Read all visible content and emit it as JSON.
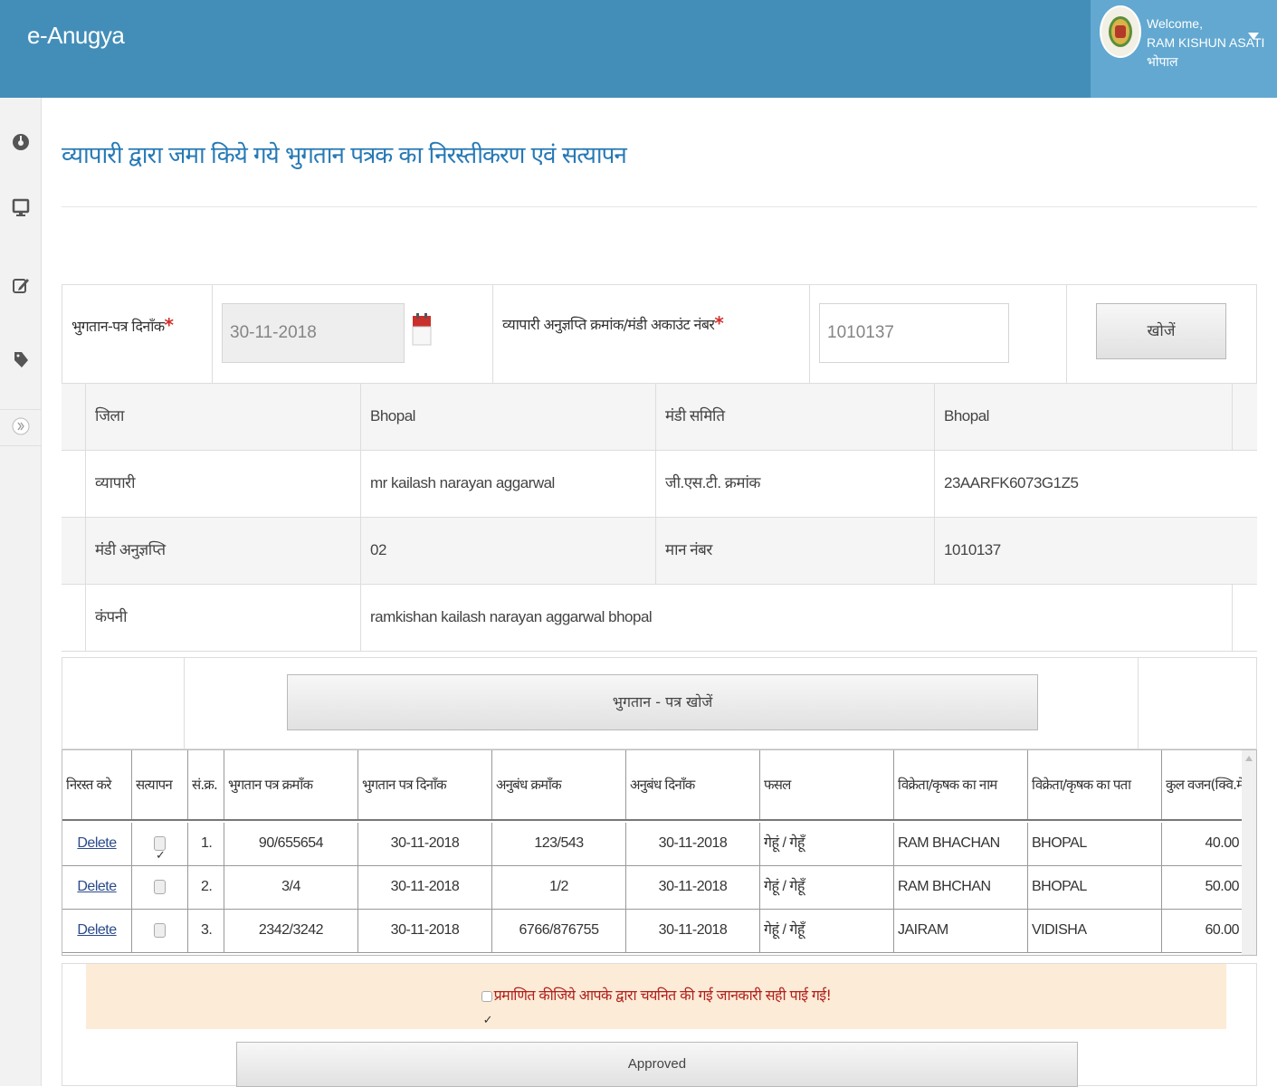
{
  "header": {
    "brand": "e-Anugya",
    "welcome": "Welcome,",
    "user_name": "RAM KISHUN ASATI",
    "user_location": "भोपाल"
  },
  "sidebar": {
    "items": [
      {
        "icon": "dashboard-icon"
      },
      {
        "icon": "desktop-icon"
      },
      {
        "icon": "edit-icon"
      },
      {
        "icon": "tag-icon"
      },
      {
        "icon": "collapse-icon"
      }
    ]
  },
  "page": {
    "title": "व्यापारी द्वारा जमा किये गये भुगतान पत्रक का निरस्तीकरण एवं सत्यापन"
  },
  "search": {
    "date_label": "भुगतान-पत्र दिनाँक",
    "date_value": "30-11-2018",
    "license_label": "व्यापारी अनुज्ञप्ति क्रमांक/मंडी अकाउंट नंबर",
    "license_value": "1010137",
    "search_button": "खोजें",
    "required_mark": "*"
  },
  "info": {
    "rows": [
      {
        "label1": "जिला",
        "value1": "Bhopal",
        "label2": "मंडी समिति",
        "value2": "Bhopal"
      },
      {
        "label1": "व्यापारी",
        "value1": "mr kailash narayan aggarwal",
        "label2": "जी.एस.टी. क्रमांक",
        "value2": "23AARFK6073G1Z5"
      },
      {
        "label1": "मंडी अनुज्ञप्ति",
        "value1": "02",
        "label2": "मान नंबर",
        "value2": "1010137"
      },
      {
        "label1": "कंपनी",
        "value1": "ramkishan kailash narayan aggarwal bhopal"
      }
    ]
  },
  "payment_search_button": "भुगतान - पत्र खोजें",
  "grid": {
    "headers": [
      "निरस्त करे",
      "सत्यापन",
      "सं.क्र.",
      "भुगतान पत्र क्रमाँक",
      "भुगतान पत्र दिनाँक",
      "अनुबंध क्रमाँक",
      "अनुबंध दिनाँक",
      "फसल",
      "विक्रेता/कृषक का नाम",
      "विक्रेता/कृषक का पता",
      "कुल वजन(क्वि.मे"
    ],
    "rows": [
      {
        "action": "Delete",
        "checked": true,
        "sno": "1.",
        "payment_no": "90/655654",
        "payment_date": "30-11-2018",
        "contract_no": "123/543",
        "contract_date": "30-11-2018",
        "crop": "गेहूं / गेहूँ",
        "seller_name": "RAM BHACHAN",
        "seller_address": "BHOPAL",
        "weight": "40.00"
      },
      {
        "action": "Delete",
        "checked": false,
        "sno": "2.",
        "payment_no": "3/4",
        "payment_date": "30-11-2018",
        "contract_no": "1/2",
        "contract_date": "30-11-2018",
        "crop": "गेहूं / गेहूँ",
        "seller_name": "RAM BHCHAN",
        "seller_address": "BHOPAL",
        "weight": "50.00"
      },
      {
        "action": "Delete",
        "checked": false,
        "sno": "3.",
        "payment_no": "2342/3242",
        "payment_date": "30-11-2018",
        "contract_no": "6766/876755",
        "contract_date": "30-11-2018",
        "crop": "गेहूं / गेहूँ",
        "seller_name": "JAIRAM",
        "seller_address": "VIDISHA",
        "weight": "60.00"
      }
    ]
  },
  "confirmation": {
    "text": "प्रमाणित कीजिये आपके द्वारा चयनित की गई जानकारी सही पाई गई!",
    "checked": true,
    "approve_button": "Approved"
  }
}
